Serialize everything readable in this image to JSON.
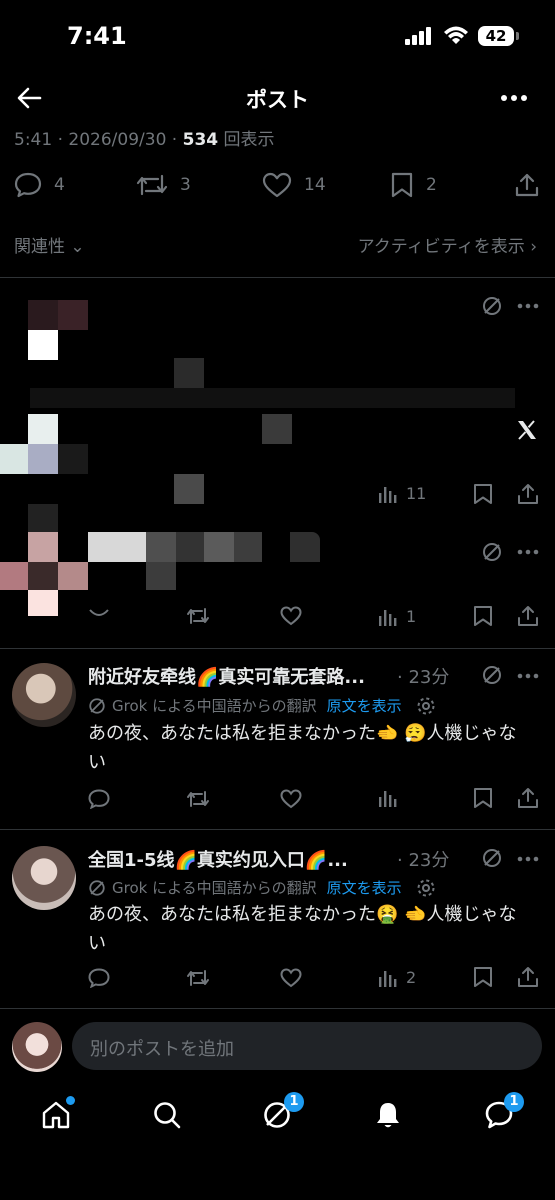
{
  "status_bar": {
    "time": "7:41",
    "battery": "42"
  },
  "header": {
    "title": "ポスト"
  },
  "post_meta": {
    "time": "5:41",
    "date": "2026/09/30",
    "views": "534",
    "views_label": "回表示"
  },
  "post_stats": {
    "replies": "4",
    "reposts": "3",
    "likes": "14",
    "bookmarks": "2"
  },
  "sort": {
    "label": "関連性",
    "activity": "アクティビティを表示"
  },
  "replies_blurred": [
    {
      "views": "11"
    },
    {
      "views": "1"
    }
  ],
  "replies": [
    {
      "name": "附近好友牵线🌈真实可靠无套路...",
      "time": "· 23分",
      "translate_note": "Grok による中国語からの翻訳",
      "show_original": "原文を表示",
      "text": "あの夜、あなたは私を拒まなかった🫲 😮‍💨人機じゃない",
      "views": ""
    },
    {
      "name": "全国1-5线🌈真实约见入口🌈...",
      "time": "· 23分",
      "translate_note": "Grok による中国語からの翻訳",
      "show_original": "原文を表示",
      "text": "あの夜、あなたは私を拒まなかった🤮 🫲人機じゃない",
      "views": "2"
    }
  ],
  "compose": {
    "placeholder": "別のポストを追加"
  },
  "bottom_nav": {
    "grok_badge": "1",
    "messages_badge": "1"
  },
  "colors": {
    "accent": "#1d9bf0",
    "muted": "#71767b",
    "divider": "#2f3336",
    "background": "#000000"
  }
}
